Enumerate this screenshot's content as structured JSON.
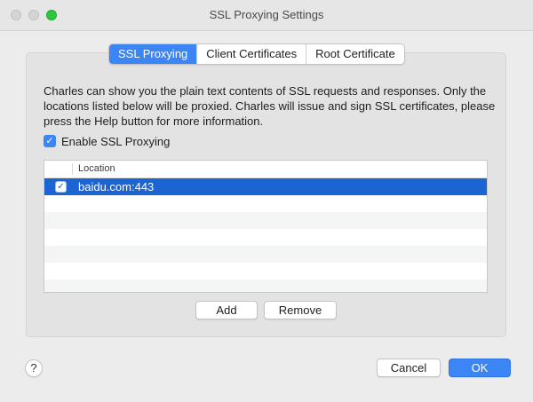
{
  "window": {
    "title": "SSL Proxying Settings"
  },
  "tabs": [
    {
      "label": "SSL Proxying",
      "active": true
    },
    {
      "label": "Client Certificates",
      "active": false
    },
    {
      "label": "Root Certificate",
      "active": false
    }
  ],
  "description": "Charles can show you the plain text contents of SSL requests and responses. Only the locations listed below will be proxied. Charles will issue and sign SSL certificates, please press the Help button for more information.",
  "enable_ssl": {
    "label": "Enable SSL Proxying",
    "checked": true,
    "check_glyph": "✓"
  },
  "table": {
    "column_header": "Location",
    "rows": [
      {
        "location": "baidu.com:443",
        "checked": true,
        "selected": true,
        "check_glyph": "✓"
      }
    ]
  },
  "buttons": {
    "add": "Add",
    "remove": "Remove",
    "cancel": "Cancel",
    "ok": "OK",
    "help": "?"
  },
  "colors": {
    "accent": "#3b85f5",
    "selection": "#1b64d4"
  },
  "icons": {
    "close": "close-icon",
    "minimize": "minimize-icon",
    "zoom": "zoom-icon",
    "help": "help-icon",
    "checkbox": "checkbox-checked-icon"
  }
}
